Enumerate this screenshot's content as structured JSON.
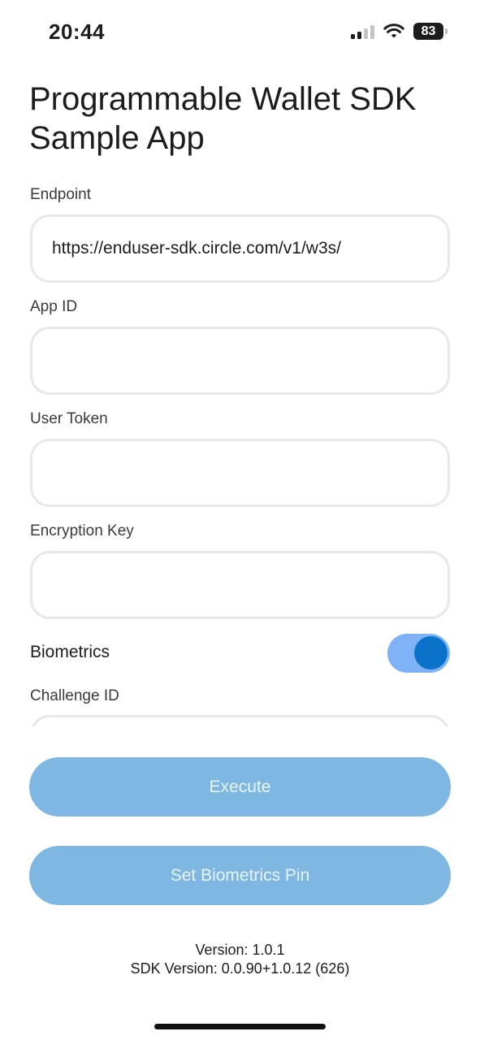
{
  "status_bar": {
    "time": "20:44",
    "battery_level": "83",
    "signal_bars_active": 2,
    "signal_bars_total": 4
  },
  "header": {
    "title": "Programmable Wallet SDK Sample App"
  },
  "form": {
    "endpoint": {
      "label": "Endpoint",
      "value": "https://enduser-sdk.circle.com/v1/w3s/"
    },
    "app_id": {
      "label": "App ID",
      "value": ""
    },
    "user_token": {
      "label": "User Token",
      "value": ""
    },
    "encryption_key": {
      "label": "Encryption Key",
      "value": ""
    },
    "biometrics": {
      "label": "Biometrics",
      "enabled": true
    },
    "challenge_id": {
      "label": "Challenge ID",
      "value": ""
    }
  },
  "actions": {
    "execute_label": "Execute",
    "set_pin_label": "Set Biometrics Pin"
  },
  "footer": {
    "version": "Version: 1.0.1",
    "sdk_version": "SDK Version: 0.0.90+1.0.12 (626)"
  },
  "colors": {
    "accent": "#0b72c9",
    "toggle_track": "#7fb1f7",
    "button_disabled": "#7eb7e1",
    "input_border": "#e8e8ea"
  },
  "icons": {
    "signal": "cellular-signal-icon",
    "wifi": "wifi-icon",
    "battery": "battery-icon"
  }
}
